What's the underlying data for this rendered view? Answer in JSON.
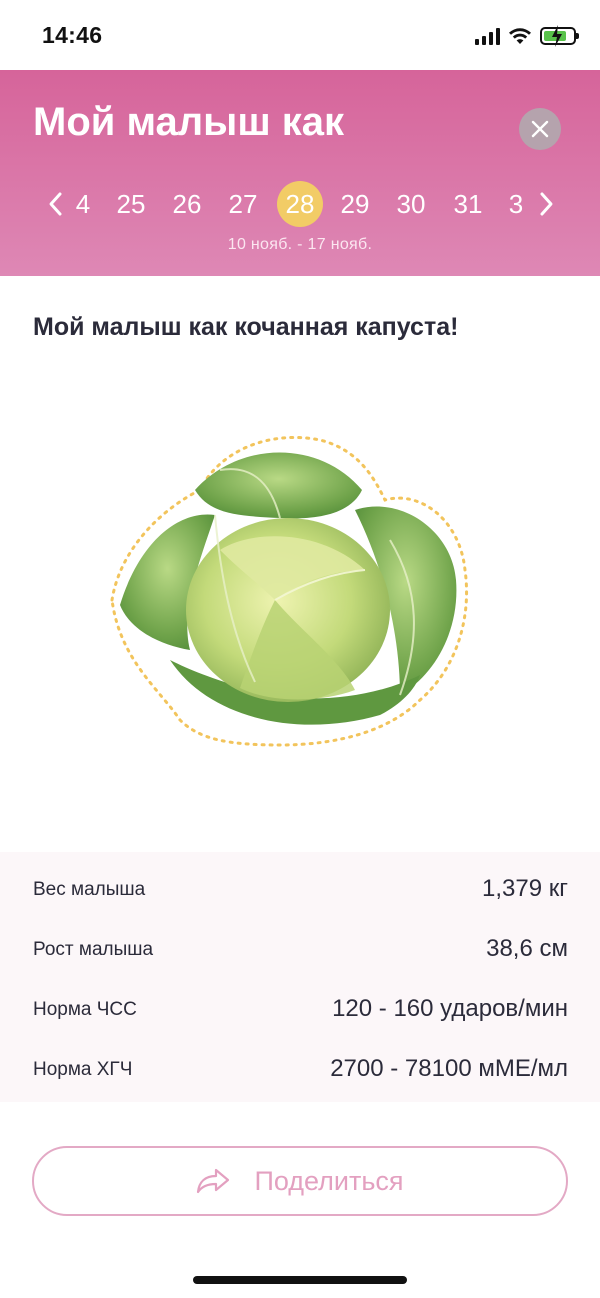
{
  "status_bar": {
    "time": "14:46"
  },
  "header": {
    "title": "Мой малыш как",
    "weeks": [
      "4",
      "25",
      "26",
      "27",
      "28",
      "29",
      "30",
      "31",
      "3"
    ],
    "active_week": "28",
    "date_range": "10 нояб. - 17 нояб."
  },
  "content": {
    "title": "Мой малыш как кочанная капуста!"
  },
  "stats": [
    {
      "label": "Вес малыша",
      "value": "1,379 кг"
    },
    {
      "label": "Рост малыша",
      "value": "38,6 см"
    },
    {
      "label": "Норма ЧСС",
      "value": "120 - 160 ударов/мин"
    },
    {
      "label": "Норма ХГЧ",
      "value": "2700 - 78100 мМЕ/мл"
    }
  ],
  "share": {
    "label": "Поделиться"
  },
  "colors": {
    "header_top": "#d6649a",
    "header_bottom": "#de88b5",
    "active_week": "#f2cc66",
    "share_accent": "#e3a0c0"
  },
  "icons": {
    "close": "close-icon",
    "prev": "chevron-left-icon",
    "next": "chevron-right-icon",
    "share": "share-arrow-icon",
    "illustration": "cabbage-illustration"
  }
}
